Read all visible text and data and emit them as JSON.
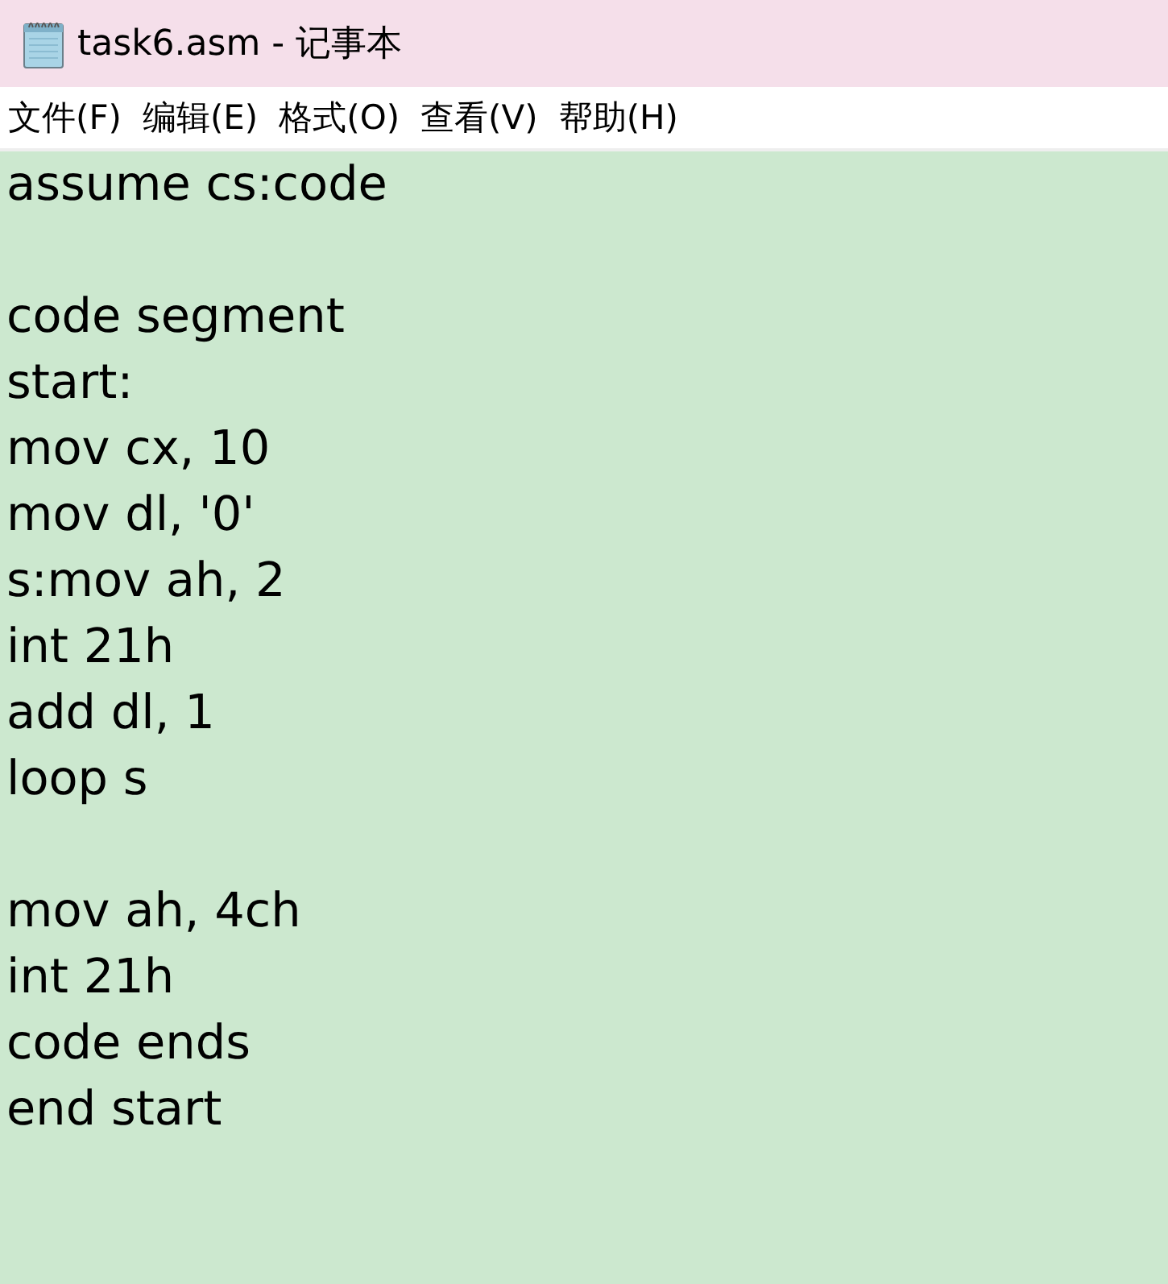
{
  "window": {
    "title": "task6.asm - 记事本"
  },
  "menu": [
    "文件(F)",
    "编辑(E)",
    "格式(O)",
    "查看(V)",
    "帮助(H)"
  ],
  "editor": {
    "blocks": [
      [
        "assume cs:code"
      ],
      [
        "code segment",
        "start:",
        "mov cx, 10",
        "mov dl, '0'",
        "s:mov ah, 2",
        "int 21h",
        "add dl, 1",
        "loop s"
      ],
      [
        "mov ah, 4ch",
        "int 21h",
        "code ends",
        "end start"
      ]
    ]
  }
}
